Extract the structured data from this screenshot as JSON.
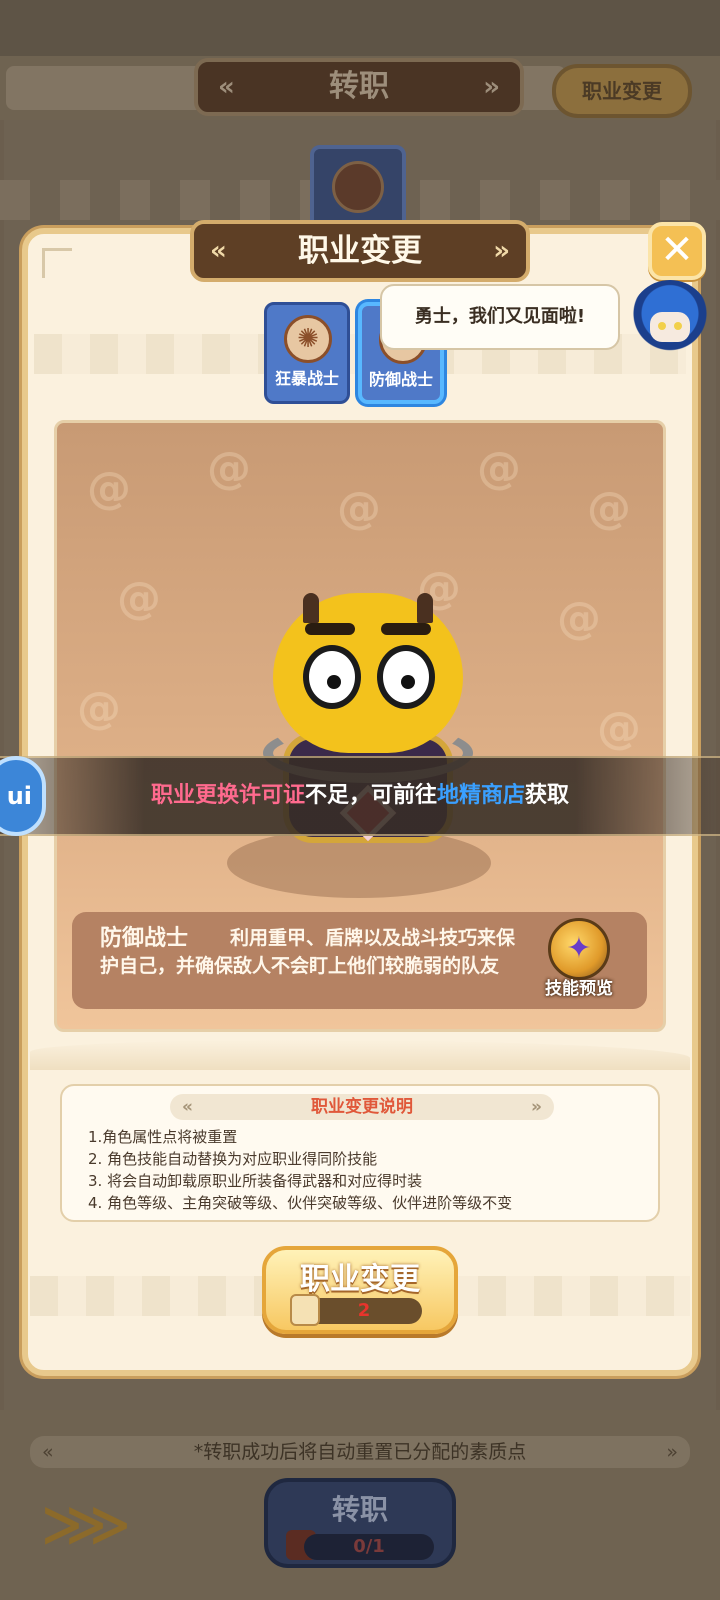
{
  "background": {
    "title": "转职",
    "change_button": "职业变更",
    "note": "*转职成功后将自动重置已分配的素质点",
    "transfer_button": "转职",
    "transfer_count": "0/1"
  },
  "dialog": {
    "title": "职业变更",
    "close_label": "✕",
    "tabs": [
      {
        "label": "狂暴战士",
        "active": false
      },
      {
        "label": "防御战士",
        "active": true
      }
    ],
    "npc_speech": "勇士，我们又见面啦!",
    "class_name": "防御战士",
    "class_desc": "利用重甲、盾牌以及战斗技巧来保护自己，并确保敌人不会盯上他们较脆弱的队友",
    "skill_preview": "技能预览",
    "toast": {
      "part1": "职业更换许可证",
      "part2": "不足，可前往",
      "part3": "地精商店",
      "part4": "获取"
    },
    "explain_title": "职业变更说明",
    "explain_items": [
      "1.角色属性点将被重置",
      "2. 角色技能自动替换为对应职业得同阶技能",
      "3. 将会自动卸载原职业所装备得武器和对应得时装",
      "4. 角色等级、主角突破等级、伙伴突破等级、伙伴进阶等级不变"
    ],
    "change_button": "职业变更",
    "cost": "2"
  },
  "colors": {
    "accent_pink": "#ff6a8e",
    "accent_blue": "#3aa0ff",
    "cost_red": "#e8342c",
    "title_brown": "#5e3f25"
  }
}
